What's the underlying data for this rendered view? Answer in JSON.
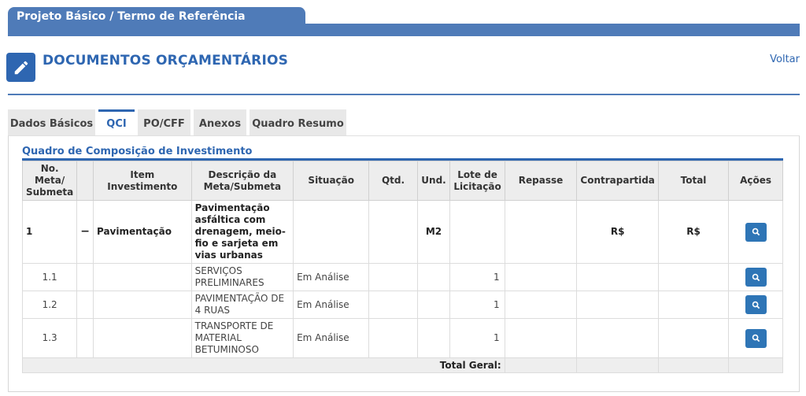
{
  "banner": {
    "title": "Projeto Básico / Termo de Referência"
  },
  "header": {
    "title": "DOCUMENTOS ORÇAMENTÁRIOS",
    "back_label": "Voltar",
    "icon": "pencil-icon"
  },
  "tabs": [
    {
      "label": "Dados Básicos",
      "active": false
    },
    {
      "label": "QCI",
      "active": true
    },
    {
      "label": "PO/CFF",
      "active": false
    },
    {
      "label": "Anexos",
      "active": false
    },
    {
      "label": "Quadro Resumo",
      "active": false
    }
  ],
  "section": {
    "title": "Quadro de Composição de Investimento"
  },
  "table": {
    "headers": {
      "meta": "No. Meta/ Submeta",
      "item": "Item Investimento",
      "descricao": "Descrição da Meta/Submeta",
      "situacao": "Situação",
      "qtd": "Qtd.",
      "und": "Und.",
      "lote": "Lote de Licitação",
      "repasse": "Repasse",
      "contrapartida": "Contrapartida",
      "total": "Total",
      "acoes": "Ações"
    },
    "rows": [
      {
        "meta": "1",
        "toggle": "−",
        "item": "Pavimentação",
        "descricao": "Pavimentação asfáltica com drenagem, meio-fio e sarjeta em vias urbanas",
        "situacao": "",
        "qtd": "",
        "und": "M2",
        "lote": "",
        "repasse": "",
        "contrapartida": "R$",
        "total": "R$"
      },
      {
        "meta": "1.1",
        "toggle": "",
        "item": "",
        "descricao": "SERVIÇOS PRELIMINARES",
        "situacao": "Em Análise",
        "qtd": "",
        "und": "",
        "lote": "1",
        "repasse": "",
        "contrapartida": "",
        "total": ""
      },
      {
        "meta": "1.2",
        "toggle": "",
        "item": "",
        "descricao": "PAVIMENTAÇÃO DE 4 RUAS",
        "situacao": "Em Análise",
        "qtd": "",
        "und": "",
        "lote": "1",
        "repasse": "",
        "contrapartida": "",
        "total": ""
      },
      {
        "meta": "1.3",
        "toggle": "",
        "item": "",
        "descricao": "TRANSPORTE DE MATERIAL BETUMINOSO",
        "situacao": "Em Análise",
        "qtd": "",
        "und": "",
        "lote": "1",
        "repasse": "",
        "contrapartida": "",
        "total": ""
      }
    ],
    "total_label": "Total Geral:"
  },
  "colors": {
    "brand": "#2e66b1",
    "banner": "#4f7bb8",
    "button": "#2e75b6"
  }
}
